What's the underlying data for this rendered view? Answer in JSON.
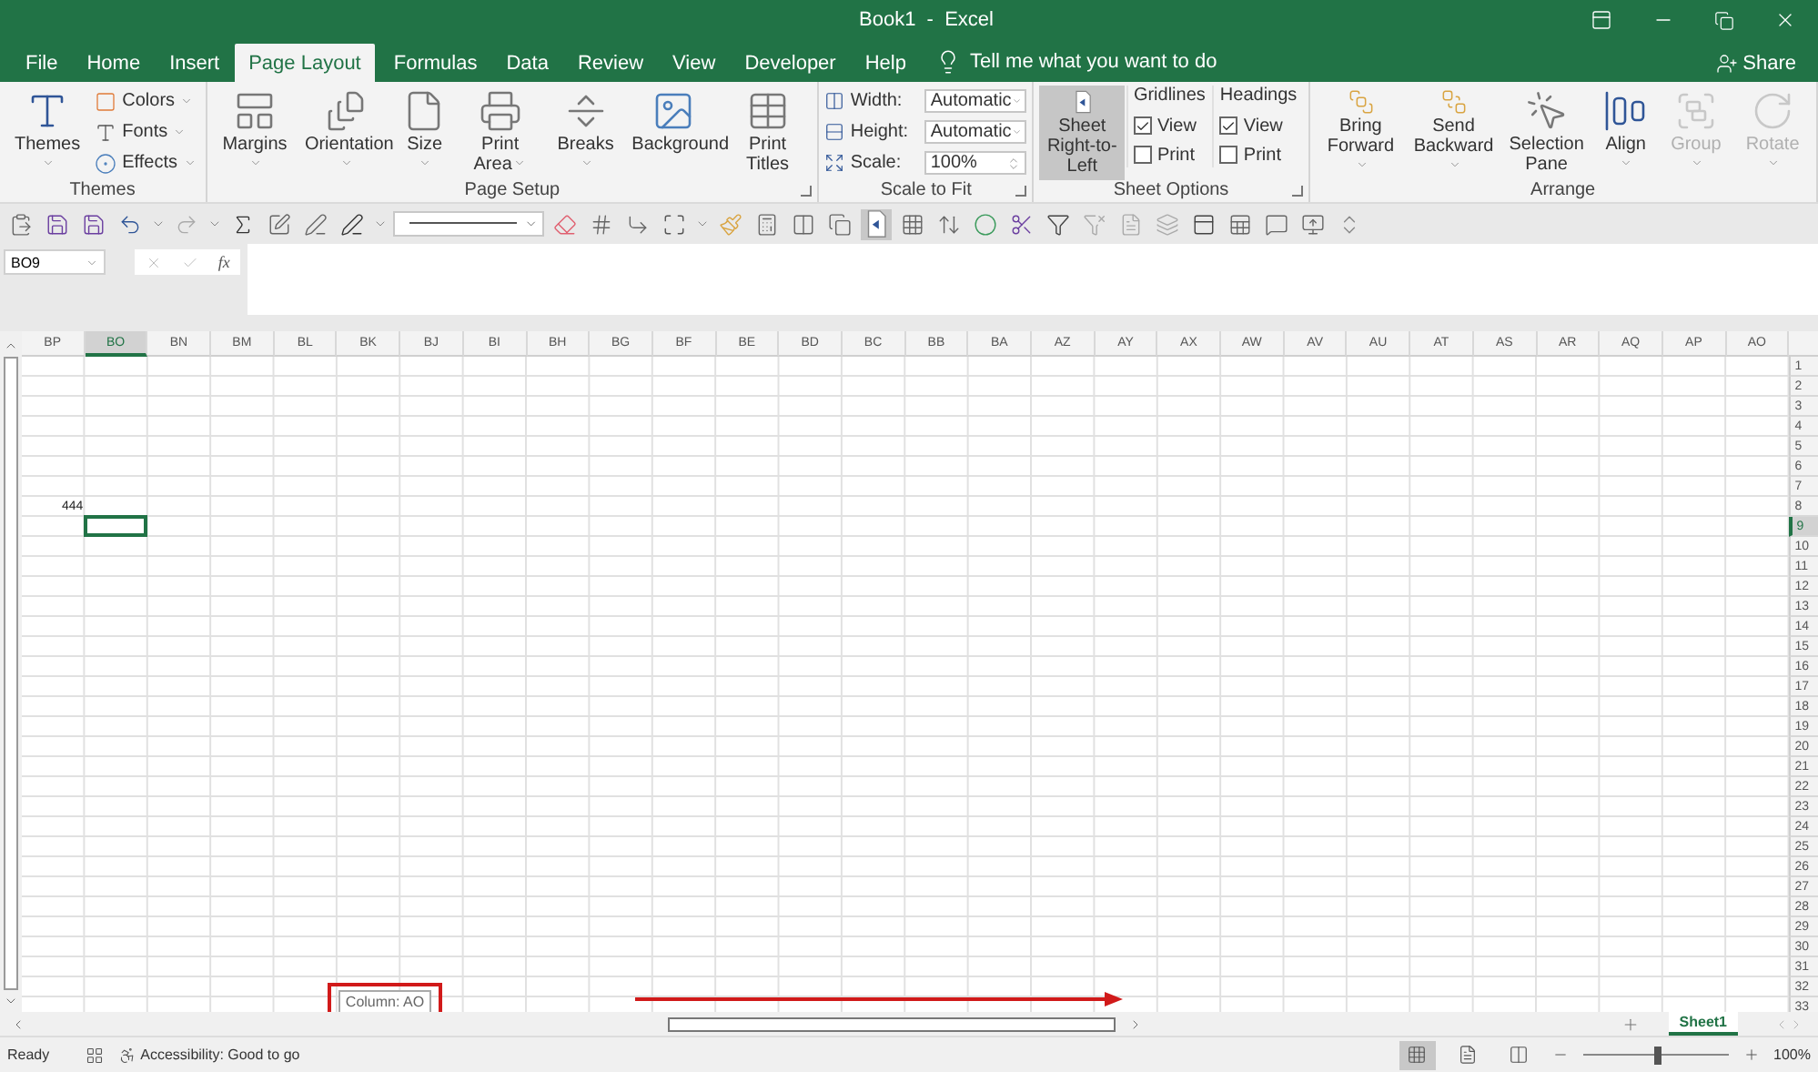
{
  "window": {
    "title": "Book1  -  Excel",
    "share": "Share"
  },
  "tabs": [
    {
      "label": "File",
      "selected": false
    },
    {
      "label": "Home",
      "selected": false
    },
    {
      "label": "Insert",
      "selected": false
    },
    {
      "label": "Page Layout",
      "selected": true
    },
    {
      "label": "Formulas",
      "selected": false
    },
    {
      "label": "Data",
      "selected": false
    },
    {
      "label": "Review",
      "selected": false
    },
    {
      "label": "View",
      "selected": false
    },
    {
      "label": "Developer",
      "selected": false
    },
    {
      "label": "Help",
      "selected": false
    }
  ],
  "tell_me": "Tell me what you want to do",
  "ribbon": [
    {
      "label": "Themes",
      "launcher": false,
      "items": [
        {
          "kind": "large",
          "label": "Themes",
          "dropdown": true,
          "selected": false,
          "disabled": false
        },
        {
          "kind": "stack",
          "entries": [
            {
              "label": "Colors"
            },
            {
              "label": "Fonts"
            },
            {
              "label": "Effects"
            }
          ]
        }
      ]
    },
    {
      "label": "Page Setup",
      "launcher": true,
      "items": [
        {
          "kind": "large",
          "label": "Margins",
          "dropdown": true,
          "selected": false,
          "disabled": false
        },
        {
          "kind": "large",
          "label": "Orientation",
          "dropdown": true,
          "selected": false,
          "disabled": false
        },
        {
          "kind": "large",
          "label": "Size",
          "dropdown": true,
          "selected": false,
          "disabled": false
        },
        {
          "kind": "large",
          "label": "Print Area",
          "dropdown": true,
          "selected": false,
          "disabled": false
        },
        {
          "kind": "large",
          "label": "Breaks",
          "dropdown": true,
          "selected": false,
          "disabled": false
        },
        {
          "kind": "large",
          "label": "Background",
          "dropdown": false,
          "selected": false,
          "disabled": false
        },
        {
          "kind": "large",
          "label": "Print Titles",
          "dropdown": false,
          "selected": false,
          "disabled": false
        }
      ]
    },
    {
      "label": "Scale to Fit",
      "launcher": true,
      "items": [
        {
          "kind": "fields",
          "entries": [
            {
              "label": "Width:",
              "value": "Automatic"
            },
            {
              "label": "Height:",
              "value": "Automatic"
            },
            {
              "label": "Scale:",
              "value": "100%"
            }
          ]
        }
      ]
    },
    {
      "label": "Sheet Options",
      "launcher": true,
      "items": [
        {
          "kind": "large",
          "label": "Sheet Right-to-Left",
          "dropdown": false,
          "selected": true,
          "disabled": false
        },
        {
          "kind": "checks",
          "title": "Gridlines",
          "entries": [
            {
              "label": "View",
              "checked": true
            },
            {
              "label": "Print",
              "checked": false
            }
          ]
        },
        {
          "kind": "checks",
          "title": "Headings",
          "entries": [
            {
              "label": "View",
              "checked": true
            },
            {
              "label": "Print",
              "checked": false
            }
          ]
        }
      ]
    },
    {
      "label": "Arrange",
      "launcher": false,
      "items": [
        {
          "kind": "large",
          "label": "Bring Forward",
          "dropdown": true,
          "selected": false,
          "disabled": false
        },
        {
          "kind": "large",
          "label": "Send Backward",
          "dropdown": true,
          "selected": false,
          "disabled": false
        },
        {
          "kind": "large",
          "label": "Selection Pane",
          "dropdown": false,
          "selected": false,
          "disabled": false
        },
        {
          "kind": "large",
          "label": "Align",
          "dropdown": true,
          "selected": false,
          "disabled": false
        },
        {
          "kind": "large",
          "label": "Group",
          "dropdown": true,
          "selected": false,
          "disabled": true
        },
        {
          "kind": "large",
          "label": "Rotate",
          "dropdown": true,
          "selected": false,
          "disabled": true
        }
      ]
    }
  ],
  "name_box": "BO9",
  "formula_label": "fx",
  "columns": [
    {
      "label": "BP",
      "selected": false
    },
    {
      "label": "BO",
      "selected": true
    },
    {
      "label": "BN",
      "selected": false
    },
    {
      "label": "BM",
      "selected": false
    },
    {
      "label": "BL",
      "selected": false
    },
    {
      "label": "BK",
      "selected": false
    },
    {
      "label": "BJ",
      "selected": false
    },
    {
      "label": "BI",
      "selected": false
    },
    {
      "label": "BH",
      "selected": false
    },
    {
      "label": "BG",
      "selected": false
    },
    {
      "label": "BF",
      "selected": false
    },
    {
      "label": "BE",
      "selected": false
    },
    {
      "label": "BD",
      "selected": false
    },
    {
      "label": "BC",
      "selected": false
    },
    {
      "label": "BB",
      "selected": false
    },
    {
      "label": "BA",
      "selected": false
    },
    {
      "label": "AZ",
      "selected": false
    },
    {
      "label": "AY",
      "selected": false
    },
    {
      "label": "AX",
      "selected": false
    },
    {
      "label": "AW",
      "selected": false
    },
    {
      "label": "AV",
      "selected": false
    },
    {
      "label": "AU",
      "selected": false
    },
    {
      "label": "AT",
      "selected": false
    },
    {
      "label": "AS",
      "selected": false
    },
    {
      "label": "AR",
      "selected": false
    },
    {
      "label": "AQ",
      "selected": false
    },
    {
      "label": "AP",
      "selected": false
    },
    {
      "label": "AO",
      "selected": false
    }
  ],
  "rows": [
    {
      "label": "1",
      "selected": false
    },
    {
      "label": "2",
      "selected": false
    },
    {
      "label": "3",
      "selected": false
    },
    {
      "label": "4",
      "selected": false
    },
    {
      "label": "5",
      "selected": false
    },
    {
      "label": "6",
      "selected": false
    },
    {
      "label": "7",
      "selected": false
    },
    {
      "label": "8",
      "selected": false,
      "cells": [
        {
          "value": "444"
        }
      ]
    },
    {
      "label": "9",
      "selected": true
    },
    {
      "label": "10",
      "selected": false
    },
    {
      "label": "11",
      "selected": false
    },
    {
      "label": "12",
      "selected": false
    },
    {
      "label": "13",
      "selected": false
    },
    {
      "label": "14",
      "selected": false
    },
    {
      "label": "15",
      "selected": false
    },
    {
      "label": "16",
      "selected": false
    },
    {
      "label": "17",
      "selected": false
    },
    {
      "label": "18",
      "selected": false
    },
    {
      "label": "19",
      "selected": false
    },
    {
      "label": "20",
      "selected": false
    },
    {
      "label": "21",
      "selected": false
    },
    {
      "label": "22",
      "selected": false
    },
    {
      "label": "23",
      "selected": false
    },
    {
      "label": "24",
      "selected": false
    },
    {
      "label": "25",
      "selected": false
    },
    {
      "label": "26",
      "selected": false
    },
    {
      "label": "27",
      "selected": false
    },
    {
      "label": "28",
      "selected": false
    },
    {
      "label": "29",
      "selected": false
    },
    {
      "label": "30",
      "selected": false
    },
    {
      "label": "31",
      "selected": false
    },
    {
      "label": "32",
      "selected": false
    },
    {
      "label": "33",
      "selected": false
    }
  ],
  "scroll_tooltip": "Column: AO",
  "sheets": [
    {
      "label": "Sheet1",
      "selected": true
    }
  ],
  "status_bar": {
    "mode": "Ready",
    "accessibility": "Accessibility: Good to go",
    "views": [
      {
        "selected": true
      },
      {
        "selected": false
      },
      {
        "selected": false
      }
    ],
    "zoom": {
      "level": 0.52
    },
    "zoom_reading": "100%"
  }
}
